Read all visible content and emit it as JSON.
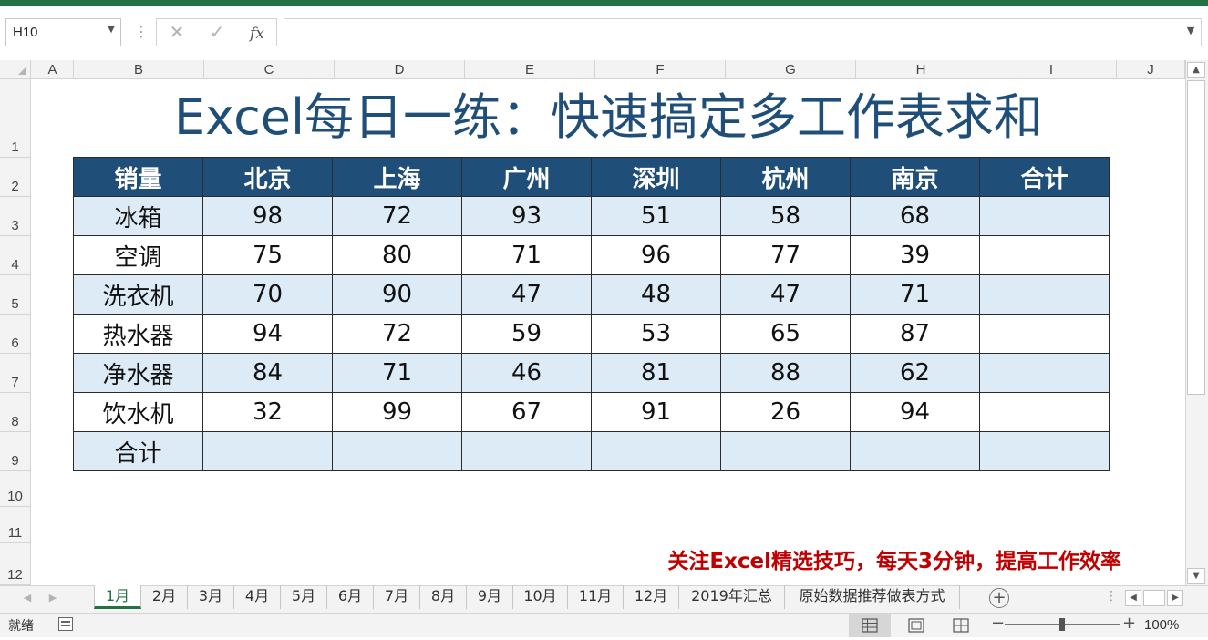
{
  "formula_bar": {
    "name_box": "H10",
    "cancel_icon": "✕",
    "enter_icon": "✓",
    "fx_label": "fx",
    "formula": ""
  },
  "columns": [
    "A",
    "B",
    "C",
    "D",
    "E",
    "F",
    "G",
    "H",
    "I",
    "J"
  ],
  "rows": [
    "1",
    "2",
    "3",
    "4",
    "5",
    "6",
    "7",
    "8",
    "9",
    "10",
    "11",
    "12"
  ],
  "title": "Excel每日一练：快速搞定多工作表求和",
  "table": {
    "header": [
      "销量",
      "北京",
      "上海",
      "广州",
      "深圳",
      "杭州",
      "南京",
      "合计"
    ],
    "rows": [
      [
        "冰箱",
        "98",
        "72",
        "93",
        "51",
        "58",
        "68",
        ""
      ],
      [
        "空调",
        "75",
        "80",
        "71",
        "96",
        "77",
        "39",
        ""
      ],
      [
        "洗衣机",
        "70",
        "90",
        "47",
        "48",
        "47",
        "71",
        ""
      ],
      [
        "热水器",
        "94",
        "72",
        "59",
        "53",
        "65",
        "87",
        ""
      ],
      [
        "净水器",
        "84",
        "71",
        "46",
        "81",
        "88",
        "62",
        ""
      ],
      [
        "饮水机",
        "32",
        "99",
        "67",
        "91",
        "26",
        "94",
        ""
      ],
      [
        "合计",
        "",
        "",
        "",
        "",
        "",
        "",
        ""
      ]
    ]
  },
  "footnote": "关注Excel精选技巧，每天3分钟，提高工作效率",
  "sheet_tabs": [
    "1月",
    "2月",
    "3月",
    "4月",
    "5月",
    "6月",
    "7月",
    "8月",
    "9月",
    "10月",
    "11月",
    "12月",
    "2019年汇总",
    "原始数据推荐做表方式"
  ],
  "active_tab": "1月",
  "status": {
    "ready": "就绪",
    "zoom": "100%"
  },
  "colors": {
    "accent": "#217346",
    "header_fill": "#1f4e79",
    "band_fill": "#ddebf7",
    "title_color": "#1f4e79",
    "footnote_color": "#c00000"
  }
}
